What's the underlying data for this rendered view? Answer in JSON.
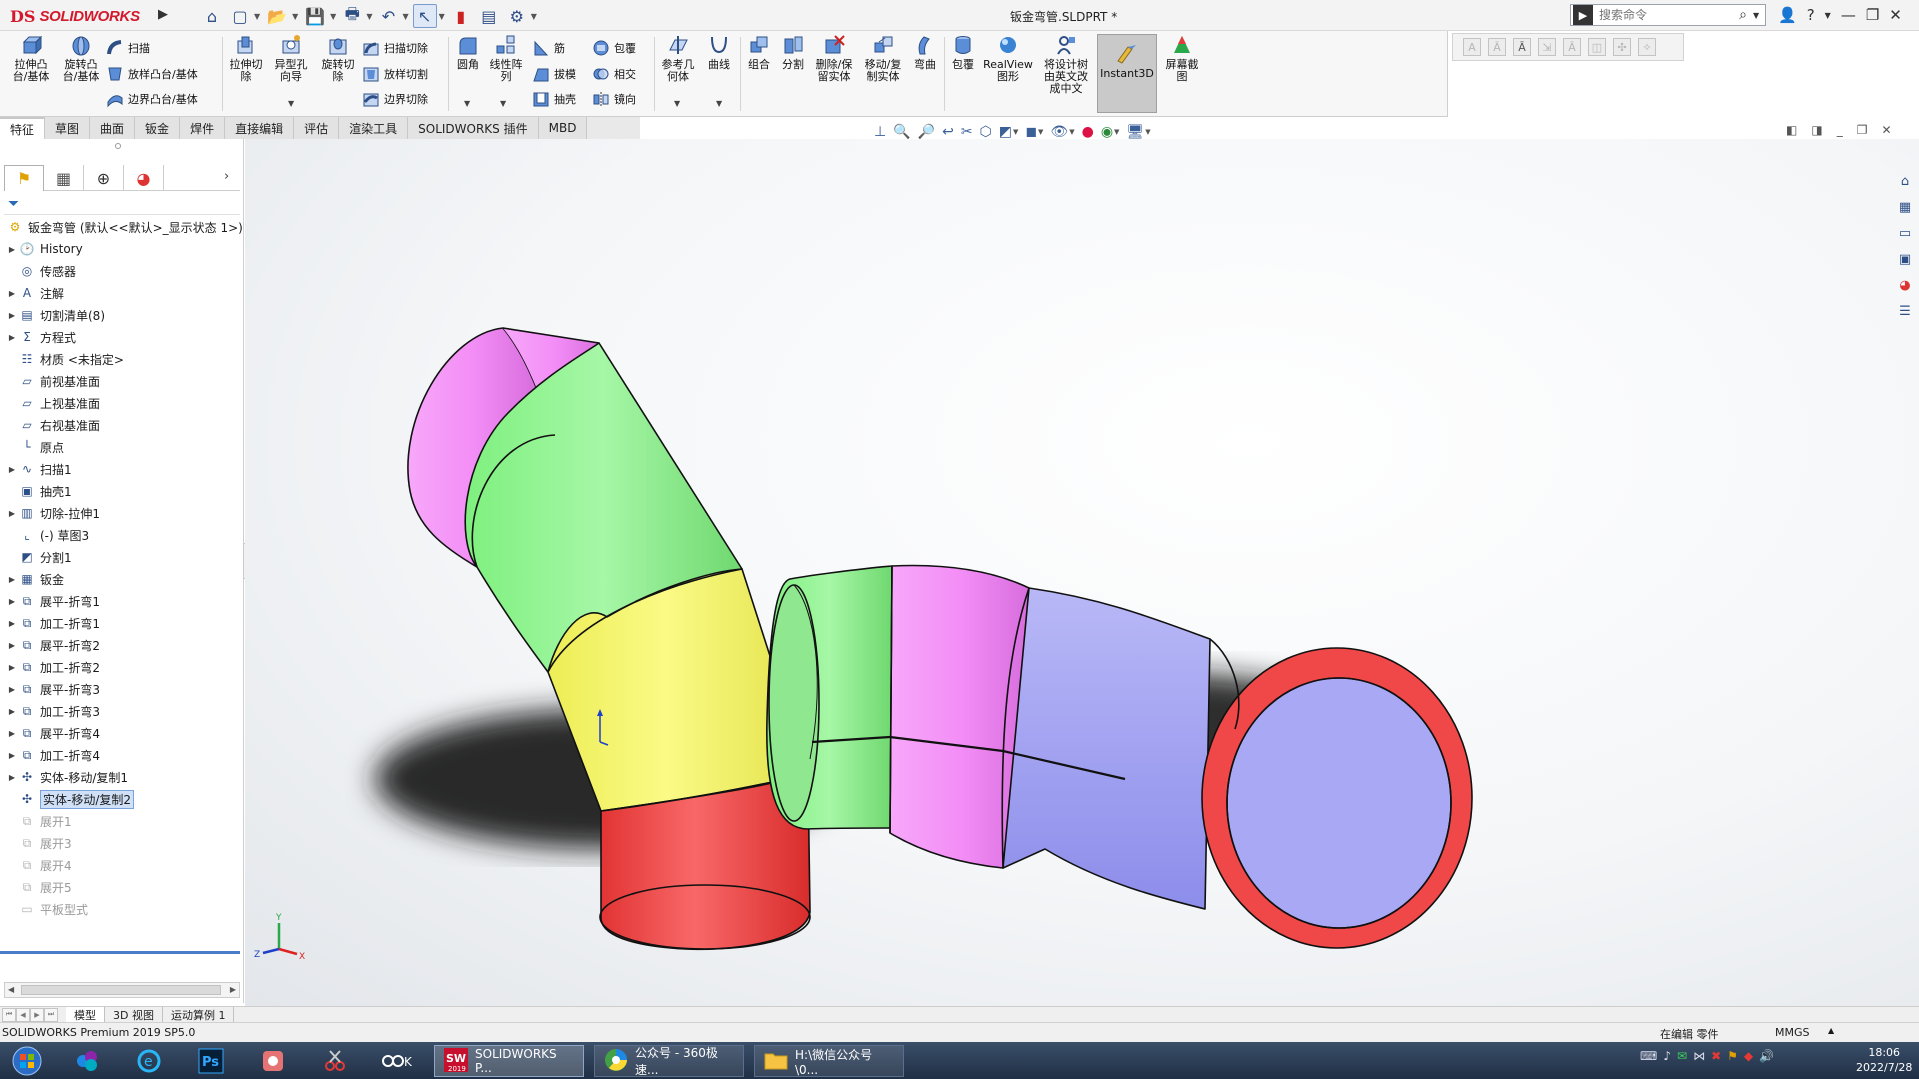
{
  "app": {
    "brand_ds": "DS",
    "brand_name": "SOLIDWORKS",
    "document_title": "钣金弯管.SLDPRT *"
  },
  "search": {
    "placeholder": "搜索命令"
  },
  "quick_access": [
    "home-icon",
    "new-icon",
    "open-icon",
    "save-icon",
    "print-icon",
    "undo-icon",
    "select-icon",
    "rebuild-icon",
    "file-props-icon",
    "options-icon"
  ],
  "command_manager": {
    "big": {
      "extrude_boss": "拉伸凸\n台/基体",
      "revolve_boss": "旋转凸\n台/基体",
      "extrude_cut": "拉伸切\n除",
      "hole_wizard": "异型孔\n向导",
      "revolve_cut": "旋转切\n除",
      "fillet": "圆角",
      "linear_pattern": "线性阵\n列",
      "ref_geometry": "参考几\n何体",
      "curves": "曲线",
      "combine": "组合",
      "split": "分割",
      "delete_keep_body": "删除/保\n留实体",
      "move_copy_body": "移动/复\n制实体",
      "flex": "弯曲",
      "wrap": "包覆",
      "realview": "RealView\n图形",
      "translate_tree": "将设计树\n由英文改\n成中文",
      "instant3d": "Instant3D",
      "screen_capture": "屏幕截\n图"
    },
    "small": {
      "sweep": "扫描",
      "loft_boss": "放样凸台/基体",
      "boundary_boss": "边界凸台/基体",
      "swept_cut": "扫描切除",
      "lofted_cut": "放样切割",
      "boundary_cut": "边界切除",
      "rib": "筋",
      "draft": "拔模",
      "shell": "抽壳",
      "wrap2": "包覆",
      "intersect": "相交",
      "mirror": "镜向"
    }
  },
  "tabs": [
    "特征",
    "草图",
    "曲面",
    "钣金",
    "焊件",
    "直接编辑",
    "评估",
    "渲染工具",
    "SOLIDWORKS 插件",
    "MBD"
  ],
  "feature_tree": {
    "root": "钣金弯管 (默认<<默认>_显示状态 1>)",
    "items": [
      {
        "label": "History",
        "icon": "history-icon",
        "expand": true,
        "state": "normal"
      },
      {
        "label": "传感器",
        "icon": "sensor-icon",
        "expand": false,
        "state": "normal"
      },
      {
        "label": "注解",
        "icon": "annotation-icon",
        "expand": true,
        "state": "normal"
      },
      {
        "label": "切割清单(8)",
        "icon": "cut-list-icon",
        "expand": true,
        "state": "normal"
      },
      {
        "label": "方程式",
        "icon": "equation-icon",
        "expand": true,
        "state": "normal"
      },
      {
        "label": "材质 <未指定>",
        "icon": "material-icon",
        "expand": false,
        "state": "normal"
      },
      {
        "label": "前视基准面",
        "icon": "plane-icon",
        "expand": false,
        "state": "normal"
      },
      {
        "label": "上视基准面",
        "icon": "plane-icon",
        "expand": false,
        "state": "normal"
      },
      {
        "label": "右视基准面",
        "icon": "plane-icon",
        "expand": false,
        "state": "normal"
      },
      {
        "label": "原点",
        "icon": "origin-icon",
        "expand": false,
        "state": "normal"
      },
      {
        "label": "扫描1",
        "icon": "sweep-feature-icon",
        "expand": true,
        "state": "normal"
      },
      {
        "label": "抽壳1",
        "icon": "shell-feature-icon",
        "expand": false,
        "state": "normal"
      },
      {
        "label": "切除-拉伸1",
        "icon": "cut-extrude-icon",
        "expand": true,
        "state": "normal"
      },
      {
        "label": "(-) 草图3",
        "icon": "sketch-icon",
        "expand": false,
        "state": "normal"
      },
      {
        "label": "分割1",
        "icon": "split-feature-icon",
        "expand": false,
        "state": "normal"
      },
      {
        "label": "钣金",
        "icon": "sheet-metal-icon",
        "expand": true,
        "state": "normal"
      },
      {
        "label": "展平-折弯1",
        "icon": "flatten-bend-icon",
        "expand": true,
        "state": "normal"
      },
      {
        "label": "加工-折弯1",
        "icon": "process-bend-icon",
        "expand": true,
        "state": "normal"
      },
      {
        "label": "展平-折弯2",
        "icon": "flatten-bend-icon",
        "expand": true,
        "state": "normal"
      },
      {
        "label": "加工-折弯2",
        "icon": "process-bend-icon",
        "expand": true,
        "state": "normal"
      },
      {
        "label": "展平-折弯3",
        "icon": "flatten-bend-icon",
        "expand": true,
        "state": "normal"
      },
      {
        "label": "加工-折弯3",
        "icon": "process-bend-icon",
        "expand": true,
        "state": "normal"
      },
      {
        "label": "展平-折弯4",
        "icon": "flatten-bend-icon",
        "expand": true,
        "state": "normal"
      },
      {
        "label": "加工-折弯4",
        "icon": "process-bend-icon",
        "expand": true,
        "state": "normal"
      },
      {
        "label": "实体-移动/复制1",
        "icon": "move-body-icon",
        "expand": true,
        "state": "normal"
      },
      {
        "label": "实体-移动/复制2",
        "icon": "move-body-icon",
        "expand": false,
        "state": "selected"
      },
      {
        "label": "展开1",
        "icon": "unfold-icon",
        "expand": false,
        "state": "suppressed"
      },
      {
        "label": "展开3",
        "icon": "unfold-icon",
        "expand": false,
        "state": "suppressed"
      },
      {
        "label": "展开4",
        "icon": "unfold-icon",
        "expand": false,
        "state": "suppressed"
      },
      {
        "label": "展开5",
        "icon": "unfold-icon",
        "expand": false,
        "state": "suppressed"
      },
      {
        "label": "平板型式",
        "icon": "flat-pattern-icon",
        "expand": false,
        "state": "suppressed"
      }
    ]
  },
  "bottom_tabs": [
    "模型",
    "3D 视图",
    "运动算例 1"
  ],
  "status": {
    "product": "SOLIDWORKS Premium 2019 SP5.0",
    "edit_mode": "在编辑 零件",
    "units": "MMGS"
  },
  "taskbar": {
    "apps": [
      {
        "label": "SOLIDWORKS P...",
        "icon": "solidworks-icon"
      },
      {
        "label": "公众号 - 360极速...",
        "icon": "browser-icon"
      },
      {
        "label": "H:\\微信公众号\\0...",
        "icon": "folder-icon"
      }
    ],
    "time": "18:06",
    "date": "2022/7/28"
  },
  "model_colors": {
    "magenta": "#ef8cf5",
    "green": "#8ef58e",
    "yellow": "#f7f56e",
    "red": "#f04848",
    "blue": "#a2a2f2"
  }
}
